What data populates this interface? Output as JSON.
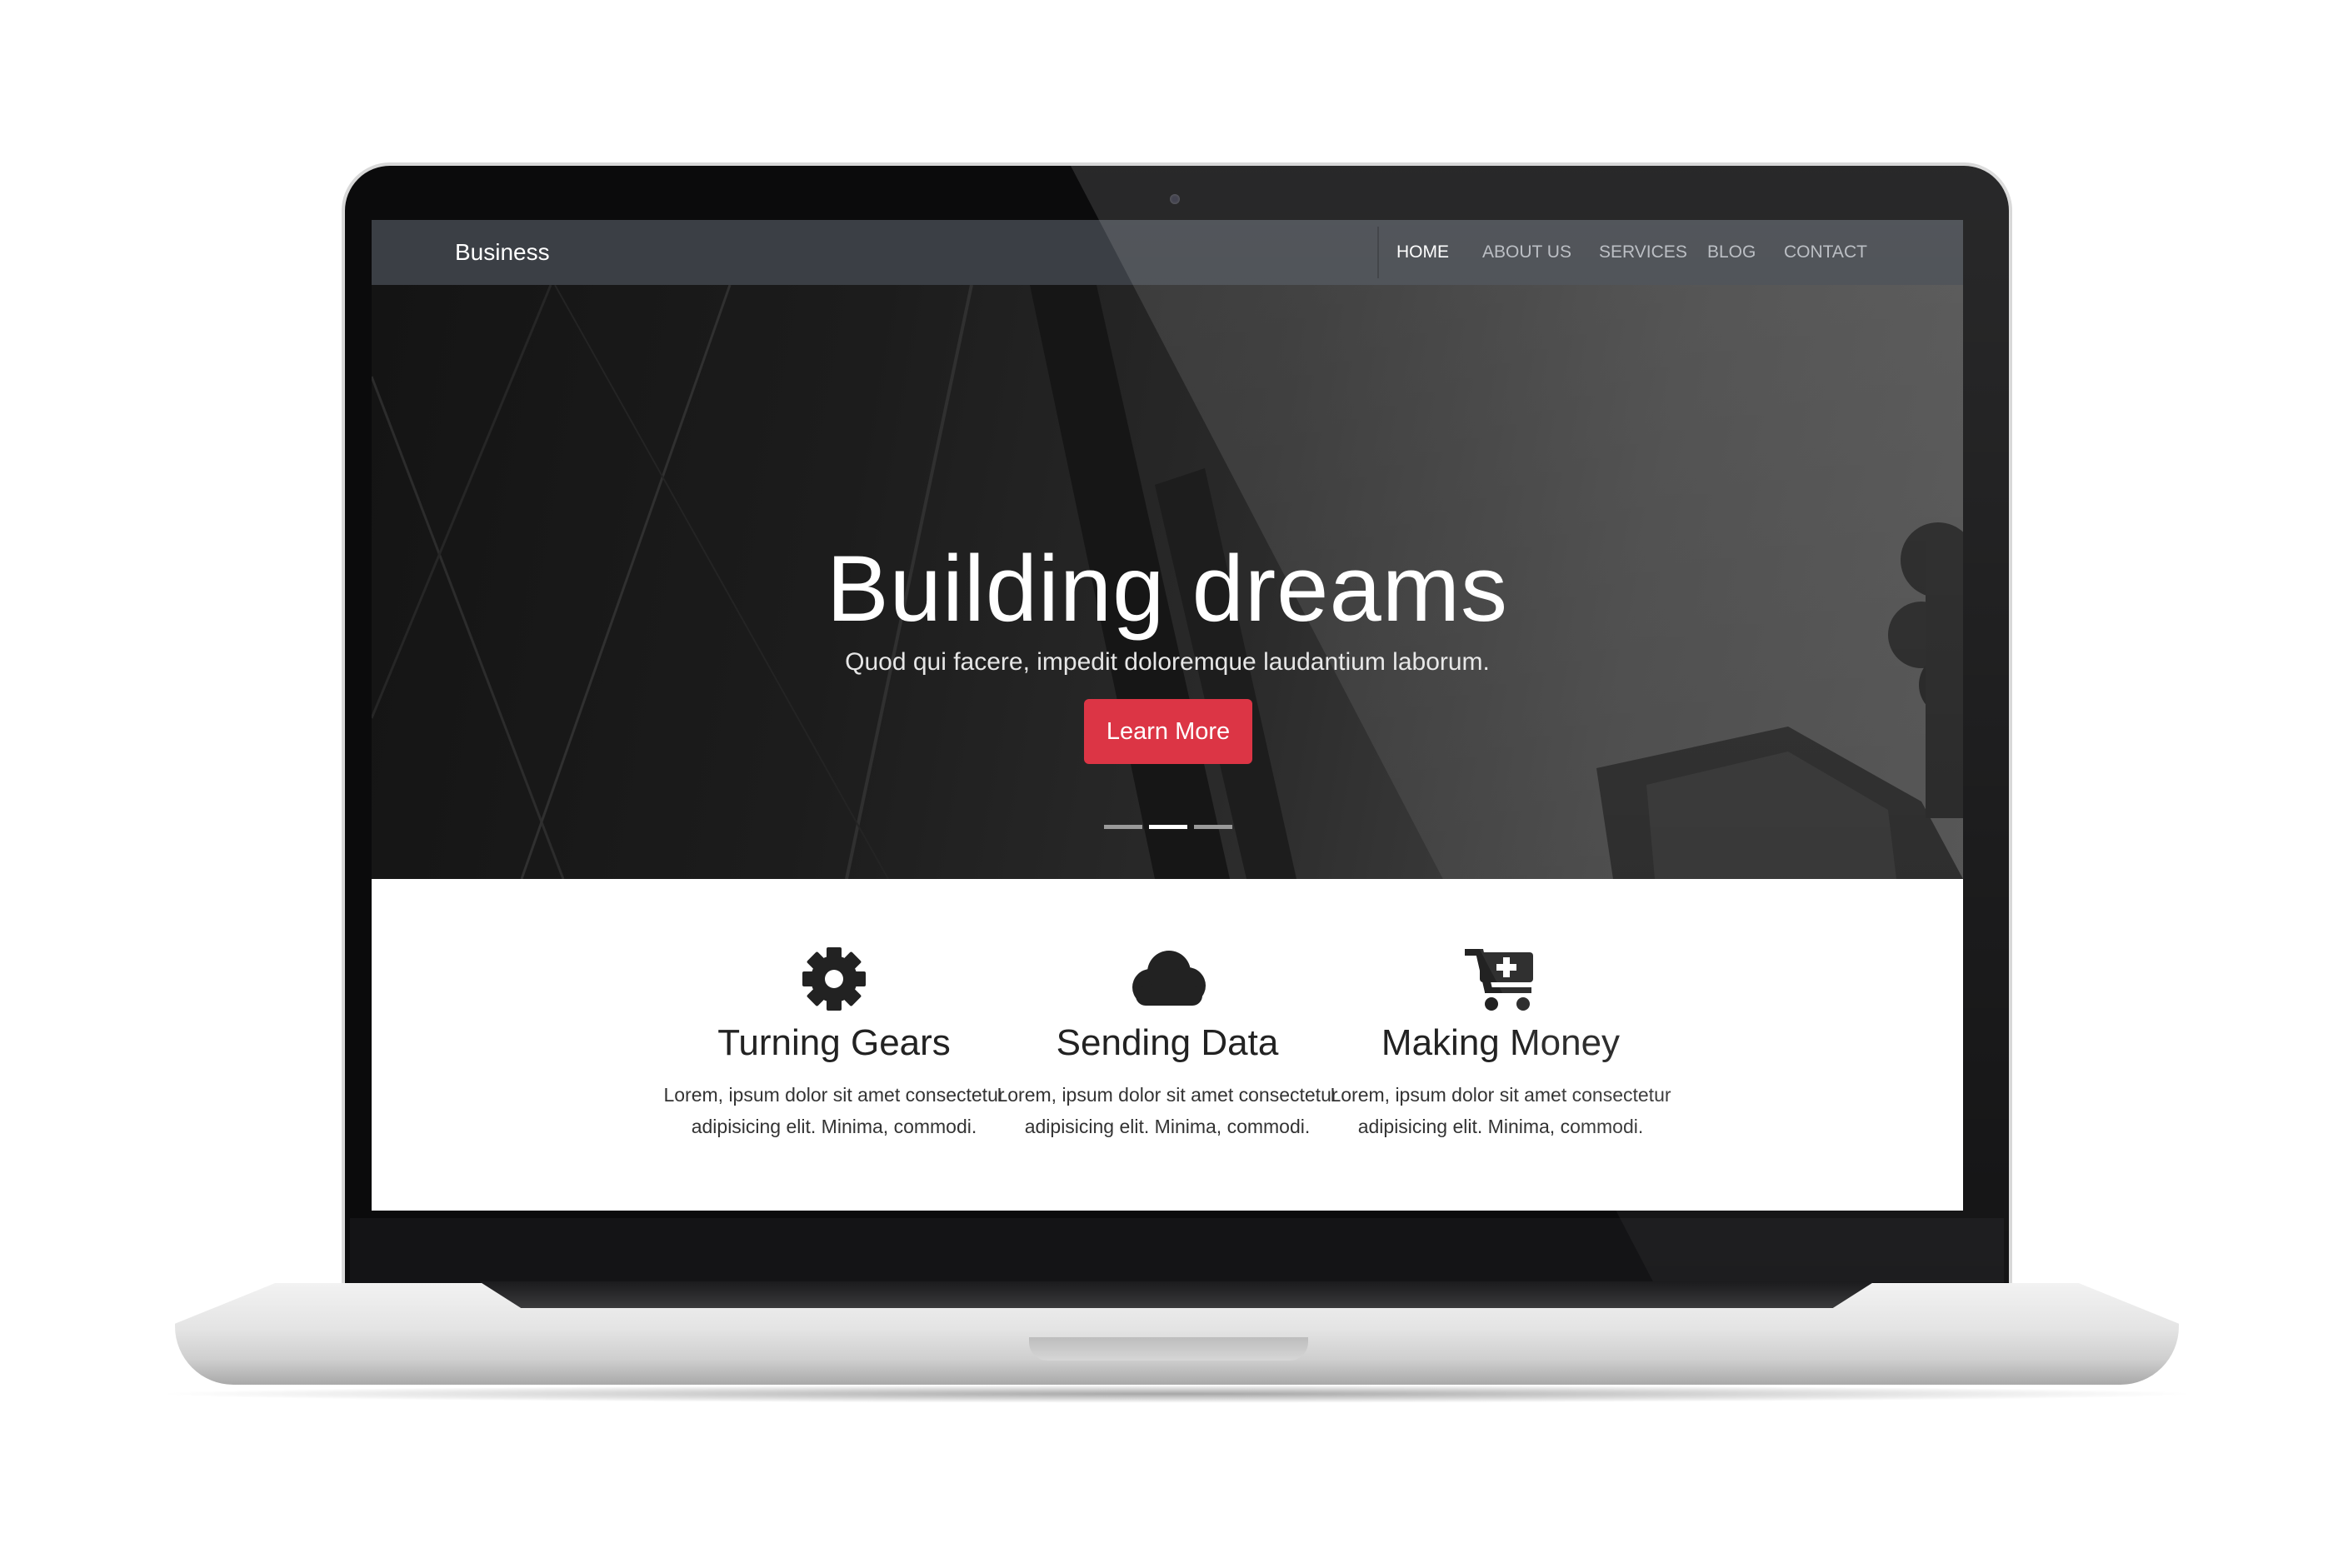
{
  "navbar": {
    "brand": "Business",
    "items": [
      {
        "label": "HOME",
        "active": true
      },
      {
        "label": "ABOUT US",
        "active": false
      },
      {
        "label": "SERVICES",
        "active": false
      },
      {
        "label": "BLOG",
        "active": false
      },
      {
        "label": "CONTACT",
        "active": false
      }
    ]
  },
  "hero": {
    "title": "Building dreams",
    "subtitle": "Quod qui facere, impedit doloremque laudantium laborum.",
    "button_label": "Learn More",
    "slides": 3,
    "active_slide": 2
  },
  "features": [
    {
      "icon": "gear-icon",
      "title": "Turning Gears",
      "text": "Lorem, ipsum dolor sit amet consectetur adipisicing elit. Minima, commodi."
    },
    {
      "icon": "cloud-icon",
      "title": "Sending Data",
      "text": "Lorem, ipsum dolor sit amet consectetur adipisicing elit. Minima, commodi."
    },
    {
      "icon": "cart-plus-icon",
      "title": "Making Money",
      "text": "Lorem, ipsum dolor sit amet consectetur adipisicing elit. Minima, commodi."
    }
  ],
  "colors": {
    "navbar": "#3b3f45",
    "accent_button": "#dc3545",
    "icon": "#222222"
  }
}
